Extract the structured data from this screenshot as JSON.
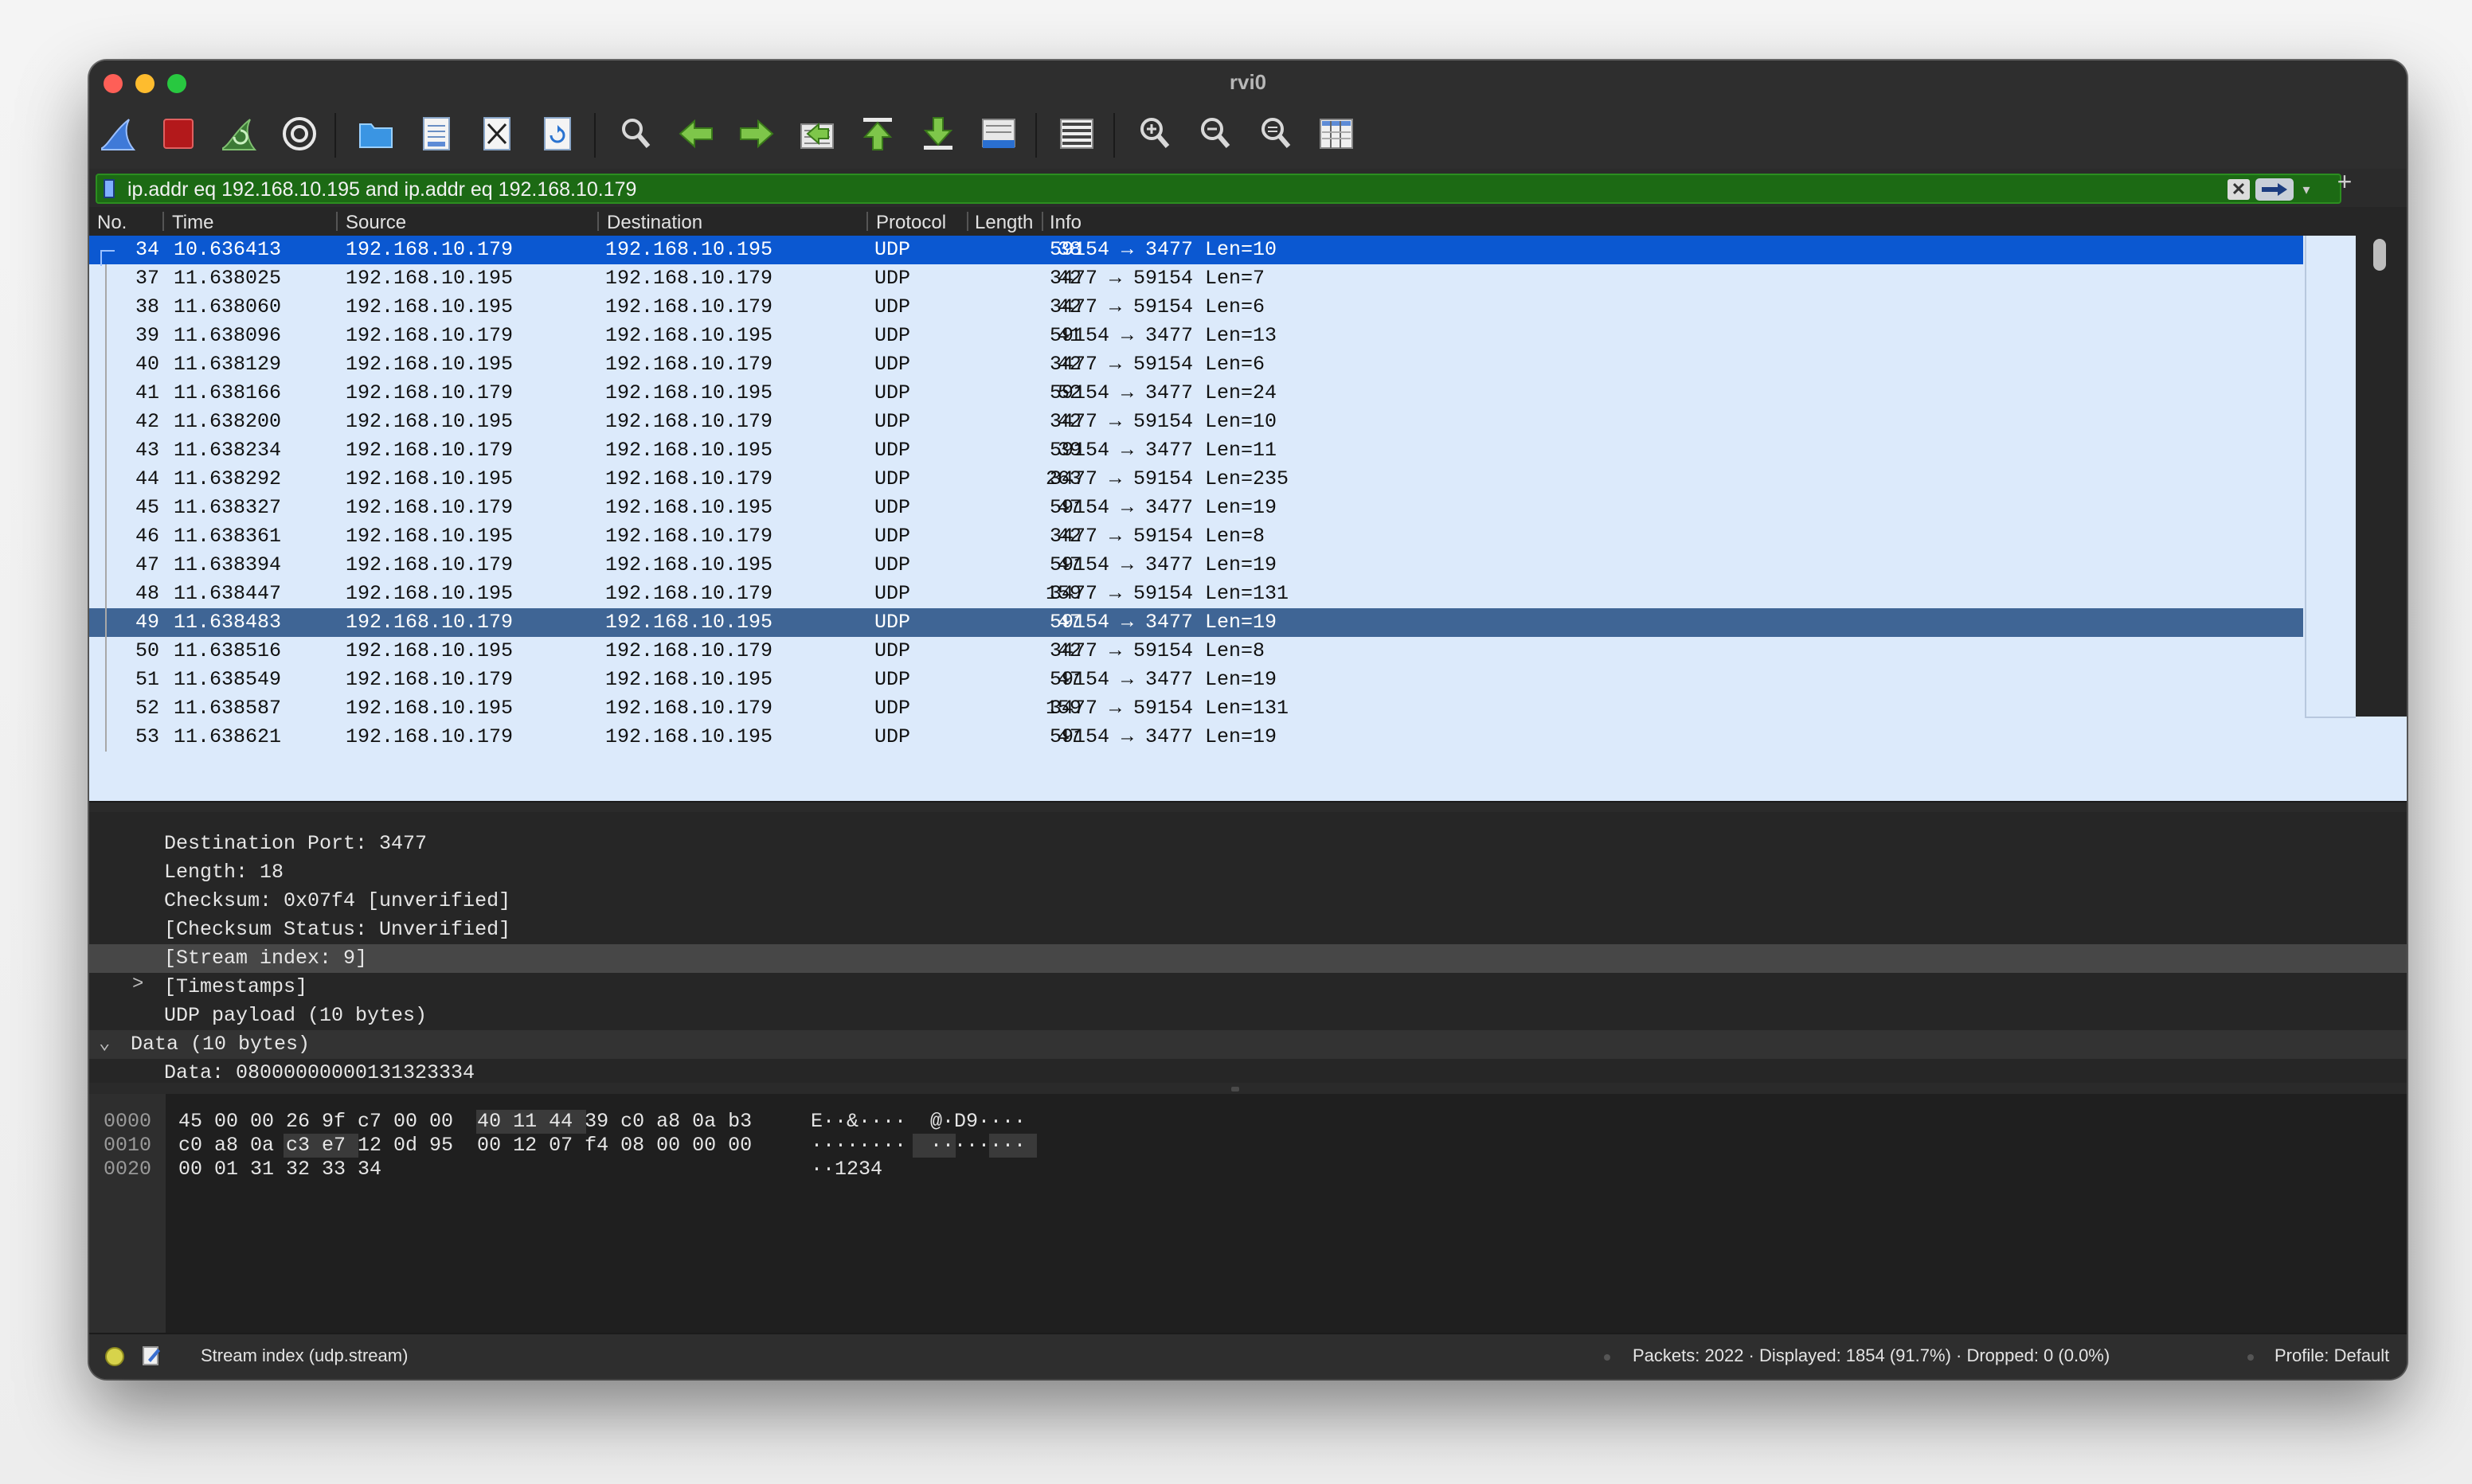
{
  "window": {
    "title": "rvi0"
  },
  "toolbar": {
    "buttons": [
      {
        "icon": "shark-fin-start-icon"
      },
      {
        "icon": "stop-capture-icon"
      },
      {
        "icon": "restart-capture-icon"
      },
      {
        "icon": "capture-options-gear-icon"
      },
      {
        "icon": "open-file-folder-icon"
      },
      {
        "icon": "save-file-icon"
      },
      {
        "icon": "close-file-icon"
      },
      {
        "icon": "reload-file-icon"
      },
      {
        "icon": "find-packet-icon"
      },
      {
        "icon": "go-back-arrow-icon"
      },
      {
        "icon": "go-forward-arrow-icon"
      },
      {
        "icon": "go-to-packet-icon"
      },
      {
        "icon": "go-first-packet-icon"
      },
      {
        "icon": "go-last-packet-icon"
      },
      {
        "icon": "autoscroll-icon"
      },
      {
        "icon": "colorize-icon"
      },
      {
        "icon": "zoom-in-icon"
      },
      {
        "icon": "zoom-out-icon"
      },
      {
        "icon": "normal-size-icon"
      },
      {
        "icon": "resize-columns-icon"
      }
    ]
  },
  "filter": {
    "value": "ip.addr eq 192.168.10.195 and ip.addr eq 192.168.10.179",
    "clear_glyph": "✕",
    "dropdown_glyph": "▾",
    "add_glyph": "+",
    "color": "#1c6a14"
  },
  "columns": {
    "no": "No.",
    "time": "Time",
    "source": "Source",
    "destination": "Destination",
    "protocol": "Protocol",
    "length": "Length",
    "info": "Info"
  },
  "packets": [
    {
      "no": "34",
      "time": "10.636413",
      "src": "192.168.10.179",
      "dst": "192.168.10.195",
      "proto": "UDP",
      "len": "38",
      "info": "59154 → 3477 Len=10",
      "state": "selected"
    },
    {
      "no": "37",
      "time": "11.638025",
      "src": "192.168.10.195",
      "dst": "192.168.10.179",
      "proto": "UDP",
      "len": "42",
      "info": "3477 → 59154 Len=7",
      "state": ""
    },
    {
      "no": "38",
      "time": "11.638060",
      "src": "192.168.10.195",
      "dst": "192.168.10.179",
      "proto": "UDP",
      "len": "42",
      "info": "3477 → 59154 Len=6",
      "state": ""
    },
    {
      "no": "39",
      "time": "11.638096",
      "src": "192.168.10.179",
      "dst": "192.168.10.195",
      "proto": "UDP",
      "len": "41",
      "info": "59154 → 3477 Len=13",
      "state": ""
    },
    {
      "no": "40",
      "time": "11.638129",
      "src": "192.168.10.195",
      "dst": "192.168.10.179",
      "proto": "UDP",
      "len": "42",
      "info": "3477 → 59154 Len=6",
      "state": ""
    },
    {
      "no": "41",
      "time": "11.638166",
      "src": "192.168.10.179",
      "dst": "192.168.10.195",
      "proto": "UDP",
      "len": "52",
      "info": "59154 → 3477 Len=24",
      "state": ""
    },
    {
      "no": "42",
      "time": "11.638200",
      "src": "192.168.10.195",
      "dst": "192.168.10.179",
      "proto": "UDP",
      "len": "42",
      "info": "3477 → 59154 Len=10",
      "state": ""
    },
    {
      "no": "43",
      "time": "11.638234",
      "src": "192.168.10.179",
      "dst": "192.168.10.195",
      "proto": "UDP",
      "len": "39",
      "info": "59154 → 3477 Len=11",
      "state": ""
    },
    {
      "no": "44",
      "time": "11.638292",
      "src": "192.168.10.195",
      "dst": "192.168.10.179",
      "proto": "UDP",
      "len": "263",
      "info": "3477 → 59154 Len=235",
      "state": ""
    },
    {
      "no": "45",
      "time": "11.638327",
      "src": "192.168.10.179",
      "dst": "192.168.10.195",
      "proto": "UDP",
      "len": "47",
      "info": "59154 → 3477 Len=19",
      "state": ""
    },
    {
      "no": "46",
      "time": "11.638361",
      "src": "192.168.10.195",
      "dst": "192.168.10.179",
      "proto": "UDP",
      "len": "42",
      "info": "3477 → 59154 Len=8",
      "state": ""
    },
    {
      "no": "47",
      "time": "11.638394",
      "src": "192.168.10.179",
      "dst": "192.168.10.195",
      "proto": "UDP",
      "len": "47",
      "info": "59154 → 3477 Len=19",
      "state": ""
    },
    {
      "no": "48",
      "time": "11.638447",
      "src": "192.168.10.195",
      "dst": "192.168.10.179",
      "proto": "UDP",
      "len": "159",
      "info": "3477 → 59154 Len=131",
      "state": ""
    },
    {
      "no": "49",
      "time": "11.638483",
      "src": "192.168.10.179",
      "dst": "192.168.10.195",
      "proto": "UDP",
      "len": "47",
      "info": "59154 → 3477 Len=19",
      "state": "highlighted"
    },
    {
      "no": "50",
      "time": "11.638516",
      "src": "192.168.10.195",
      "dst": "192.168.10.179",
      "proto": "UDP",
      "len": "42",
      "info": "3477 → 59154 Len=8",
      "state": ""
    },
    {
      "no": "51",
      "time": "11.638549",
      "src": "192.168.10.179",
      "dst": "192.168.10.195",
      "proto": "UDP",
      "len": "47",
      "info": "59154 → 3477 Len=19",
      "state": ""
    },
    {
      "no": "52",
      "time": "11.638587",
      "src": "192.168.10.195",
      "dst": "192.168.10.179",
      "proto": "UDP",
      "len": "159",
      "info": "3477 → 59154 Len=131",
      "state": ""
    },
    {
      "no": "53",
      "time": "11.638621",
      "src": "192.168.10.179",
      "dst": "192.168.10.195",
      "proto": "UDP",
      "len": "47",
      "info": "59154 → 3477 Len=19",
      "state": ""
    }
  ],
  "details": [
    {
      "text": "Destination Port: 3477",
      "indent": 2,
      "style": "",
      "chevron": ""
    },
    {
      "text": "Length: 18",
      "indent": 2,
      "style": "",
      "chevron": ""
    },
    {
      "text": "Checksum: 0x07f4 [unverified]",
      "indent": 2,
      "style": "",
      "chevron": ""
    },
    {
      "text": "[Checksum Status: Unverified]",
      "indent": 2,
      "style": "",
      "chevron": ""
    },
    {
      "text": "[Stream index: 9]",
      "indent": 2,
      "style": "selected",
      "chevron": ""
    },
    {
      "text": "[Timestamps]",
      "indent": 2,
      "style": "",
      "chevron": ">"
    },
    {
      "text": "UDP payload (10 bytes)",
      "indent": 2,
      "style": "",
      "chevron": ""
    },
    {
      "text": "Data (10 bytes)",
      "indent": 1,
      "style": "group",
      "chevron": "⌄"
    },
    {
      "text": "Data: 08000000000131323334",
      "indent": 2,
      "style": "",
      "chevron": ""
    }
  ],
  "bytes": [
    {
      "offset": "0000",
      "hex": "45 00 00 26 9f c7 00 00  40 11 44 39 c0 a8 0a b3",
      "ascii": "E··&····  @·D9····"
    },
    {
      "offset": "0010",
      "hex": "c0 a8 0a c3 e7 12 0d 95  00 12 07 f4 08 00 00 00",
      "ascii": "········  ········"
    },
    {
      "offset": "0020",
      "hex": "00 01 31 32 33 34",
      "ascii": "··1234"
    }
  ],
  "status": {
    "field": "Stream index (udp.stream)",
    "packets": "Packets: 2022 · Displayed: 1854 (91.7%) · Dropped: 0 (0.0%)",
    "profile": "Profile: Default"
  }
}
